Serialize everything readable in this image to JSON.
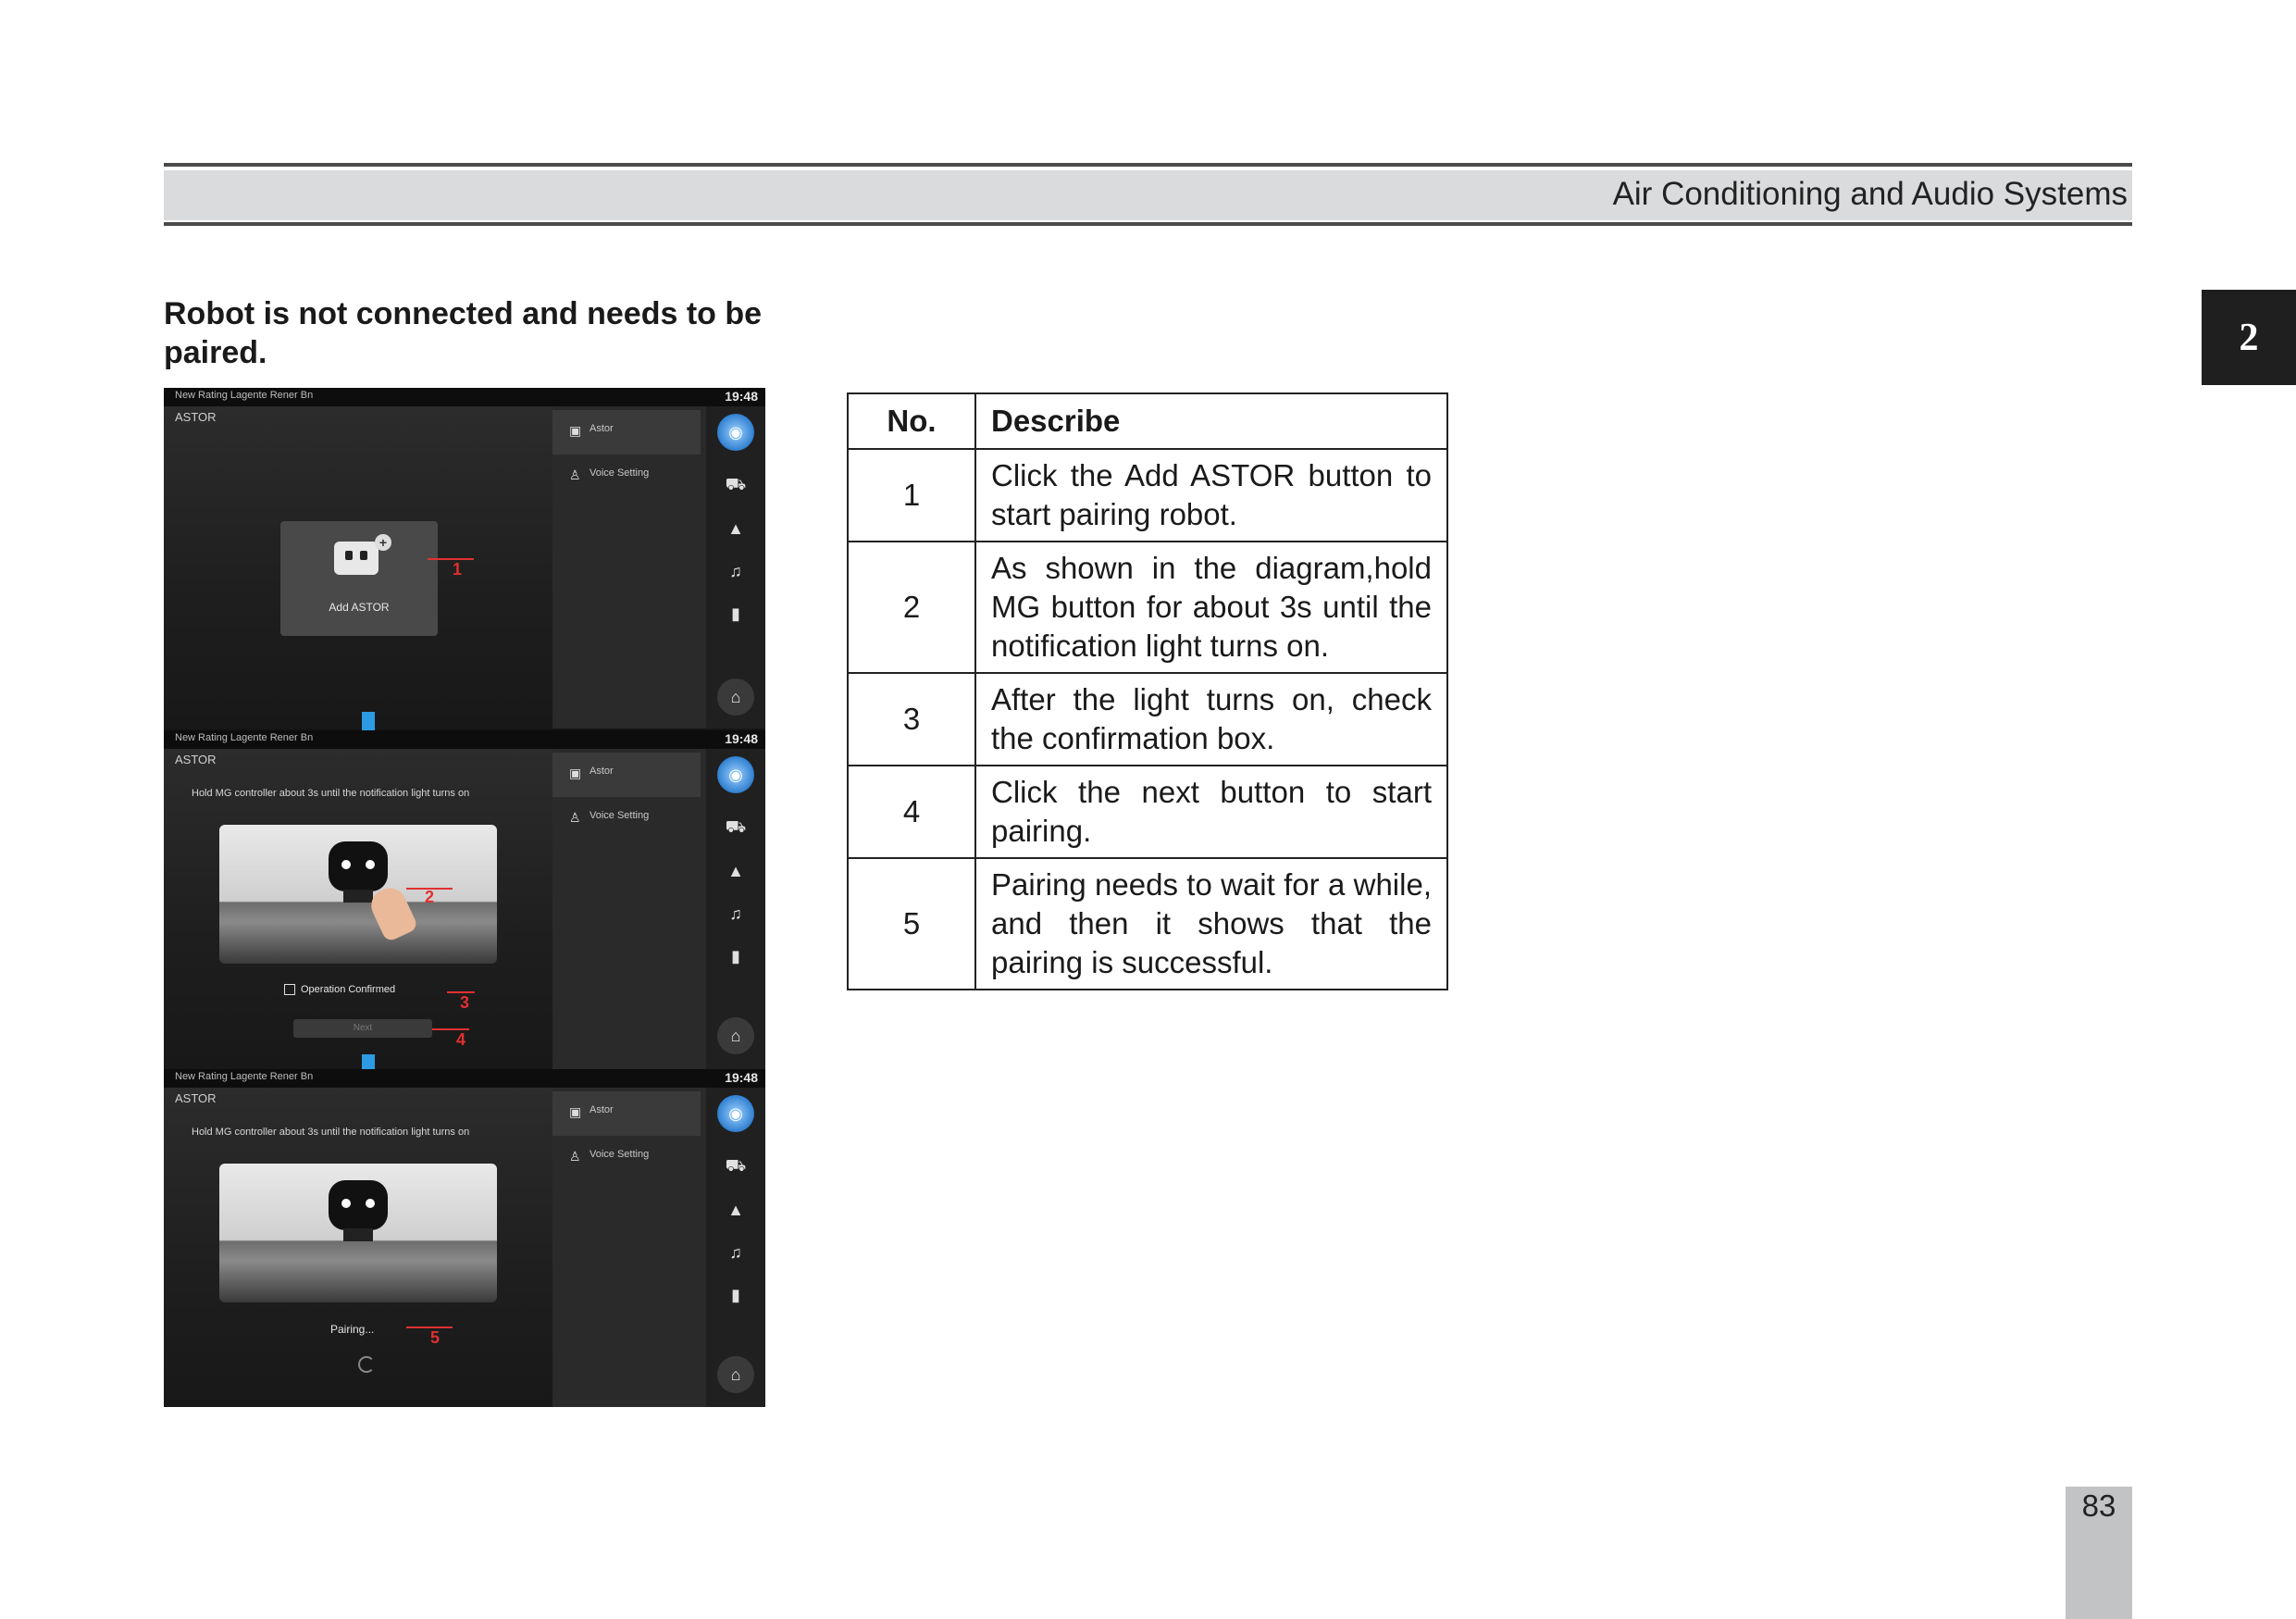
{
  "header": {
    "title": "Air Conditioning and Audio Systems"
  },
  "chapter_tab": "2",
  "section": {
    "heading": "Robot is not connected and needs to be paired."
  },
  "figure": {
    "status_left": "New Rating Lagente Rener Bn",
    "status_time": "19:48",
    "app_title": "ASTOR",
    "menu_items": [
      "Astor",
      "Voice Setting"
    ],
    "panel1": {
      "add_label": "Add ASTOR",
      "callout": "1"
    },
    "panel2": {
      "instruction": "Hold MG controller about 3s until the notification light turns on",
      "checkbox_label": "Operation Confirmed",
      "next_label": "Next",
      "callouts": [
        "2",
        "3",
        "4"
      ]
    },
    "panel3": {
      "instruction": "Hold MG controller about 3s until the notification light turns on",
      "pairing_label": "Pairing...",
      "callout": "5"
    },
    "dock_icons": [
      "robot-icon",
      "car-icon",
      "navigation-icon",
      "music-icon",
      "phone-icon",
      "home-icon"
    ]
  },
  "table": {
    "headers": {
      "no": "No.",
      "describe": "Describe"
    },
    "rows": [
      {
        "no": "1",
        "text": "Click the Add ASTOR button to start pairing robot."
      },
      {
        "no": "2",
        "text": "As shown in the diagram,hold MG button for about 3s until the notification light turns on."
      },
      {
        "no": "3",
        "text": "After the light turns on, check the confirmation box."
      },
      {
        "no": "4",
        "text": "Click the next button to start pairing."
      },
      {
        "no": "5",
        "text": "Pairing needs to wait for a while, and then it shows that the pairing is successful."
      }
    ]
  },
  "page_number": "83"
}
